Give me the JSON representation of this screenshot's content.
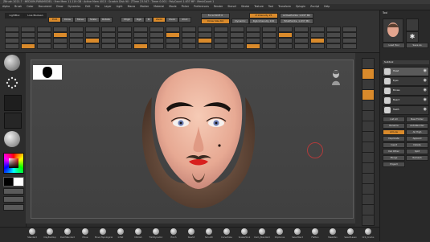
{
  "titlebar": {
    "text": "ZBrush 2021.7  ·  MEDIUM-PARAMODEL  ·  Free Mem 11.119 GB  ·  Active Mem 4013  ·  Scratch Disk 90  ·  ZTime 23.547  ·  Timer 0.001  ·  PolyCount 1.637 MP  ·  MeshCount 1"
  },
  "menubar": {
    "items": [
      "Alpha",
      "Brush",
      "Color",
      "Document",
      "Draw",
      "Dynamics",
      "Edit",
      "File",
      "Layer",
      "Light",
      "Macro",
      "Marker",
      "Material",
      "Movie",
      "Picker",
      "Preferences",
      "Render",
      "Stencil",
      "Stroke",
      "Texture",
      "Tool",
      "Transform",
      "Zplugin",
      "Zscript",
      "Help"
    ]
  },
  "shelf": {
    "buttons": [
      {
        "label": "LightBox",
        "style": "dark"
      },
      {
        "label": "Live Boolean",
        "style": "dark"
      },
      {
        "label": "Edit",
        "style": "orange"
      },
      {
        "label": "Draw",
        "style": ""
      },
      {
        "label": "Move",
        "style": ""
      },
      {
        "label": "Scale",
        "style": ""
      },
      {
        "label": "Rotate",
        "style": ""
      },
      {
        "label": "Mrgb",
        "style": ""
      },
      {
        "label": "Rgb",
        "style": ""
      },
      {
        "label": "M",
        "style": ""
      },
      {
        "label": "Zadd",
        "style": "orange"
      },
      {
        "label": "Zsub",
        "style": ""
      },
      {
        "label": "Zcut",
        "style": ""
      },
      {
        "label": "Focal Shift 0",
        "style": ""
      },
      {
        "label": "Draw Size 64",
        "style": "orange"
      },
      {
        "label": "Dynamic",
        "style": ""
      },
      {
        "label": "Z Intensity 25",
        "style": "orange"
      },
      {
        "label": "Rgb Intensity 100",
        "style": ""
      },
      {
        "label": "ActivePoints: 1.637 Mil",
        "style": ""
      },
      {
        "label": "TotalPoints: 1.637 Mil",
        "style": ""
      }
    ],
    "tools": [
      "Projection Master",
      "QuickSketch",
      "Scroll",
      "Zoom",
      "Actual",
      "AAHalf"
    ]
  },
  "left_tray": {
    "labels": [
      "Standard",
      "Dots",
      "Alpha Off",
      "Texture Off",
      "MatCap Gray",
      "Gradient",
      "SwitchColor"
    ]
  },
  "right_tray": {
    "labels": [
      "BPR",
      "SPix 3",
      "Scroll",
      "Zoom",
      "Actual",
      "AAHalf",
      "Persp",
      "Floor",
      "Local",
      "Frame",
      "Move",
      "Scale",
      "Rotate",
      "PolyF",
      "Transp",
      "Solo"
    ]
  },
  "palette": {
    "header": "Tool",
    "buttons": [
      "Load Tool",
      "Save As",
      "Copy Tool",
      "Paste Tool",
      "Import",
      "Export",
      "Clone",
      "Make PolyMesh3D",
      "GoZ",
      "All",
      "Visible",
      "R"
    ],
    "subtool_title": "Subtool",
    "subtools": [
      "Head",
      "Eyes",
      "Brows",
      "Beard",
      "Teeth"
    ],
    "lower_buttons": [
      "List All",
      "New Folder",
      "Rename",
      "AutoReorder",
      "All Low",
      "All High",
      "Duplicate",
      "Append",
      "Insert",
      "Delete",
      "Del Other",
      "Split",
      "Merge",
      "Remesh",
      "Project"
    ]
  },
  "bottombar": {
    "items": [
      "Standard",
      "ClayBuildup",
      "DamStandard",
      "Move",
      "Move Topological",
      "Inflat",
      "hPolish",
      "TrimDynamic",
      "Pinch",
      "Slash3",
      "Smooth",
      "CurveTube",
      "SnakeHook",
      "Dam_Standard",
      "ClipCurve",
      "SelectRect",
      "Flatten",
      "MaskPen",
      "SelectLasso",
      "Orb_Cracks"
    ]
  },
  "canvas": {
    "subject": "painted mask face"
  },
  "colors": {
    "accent": "#d98a2b",
    "background": "#2b2b2b",
    "canvas": "#444444"
  }
}
